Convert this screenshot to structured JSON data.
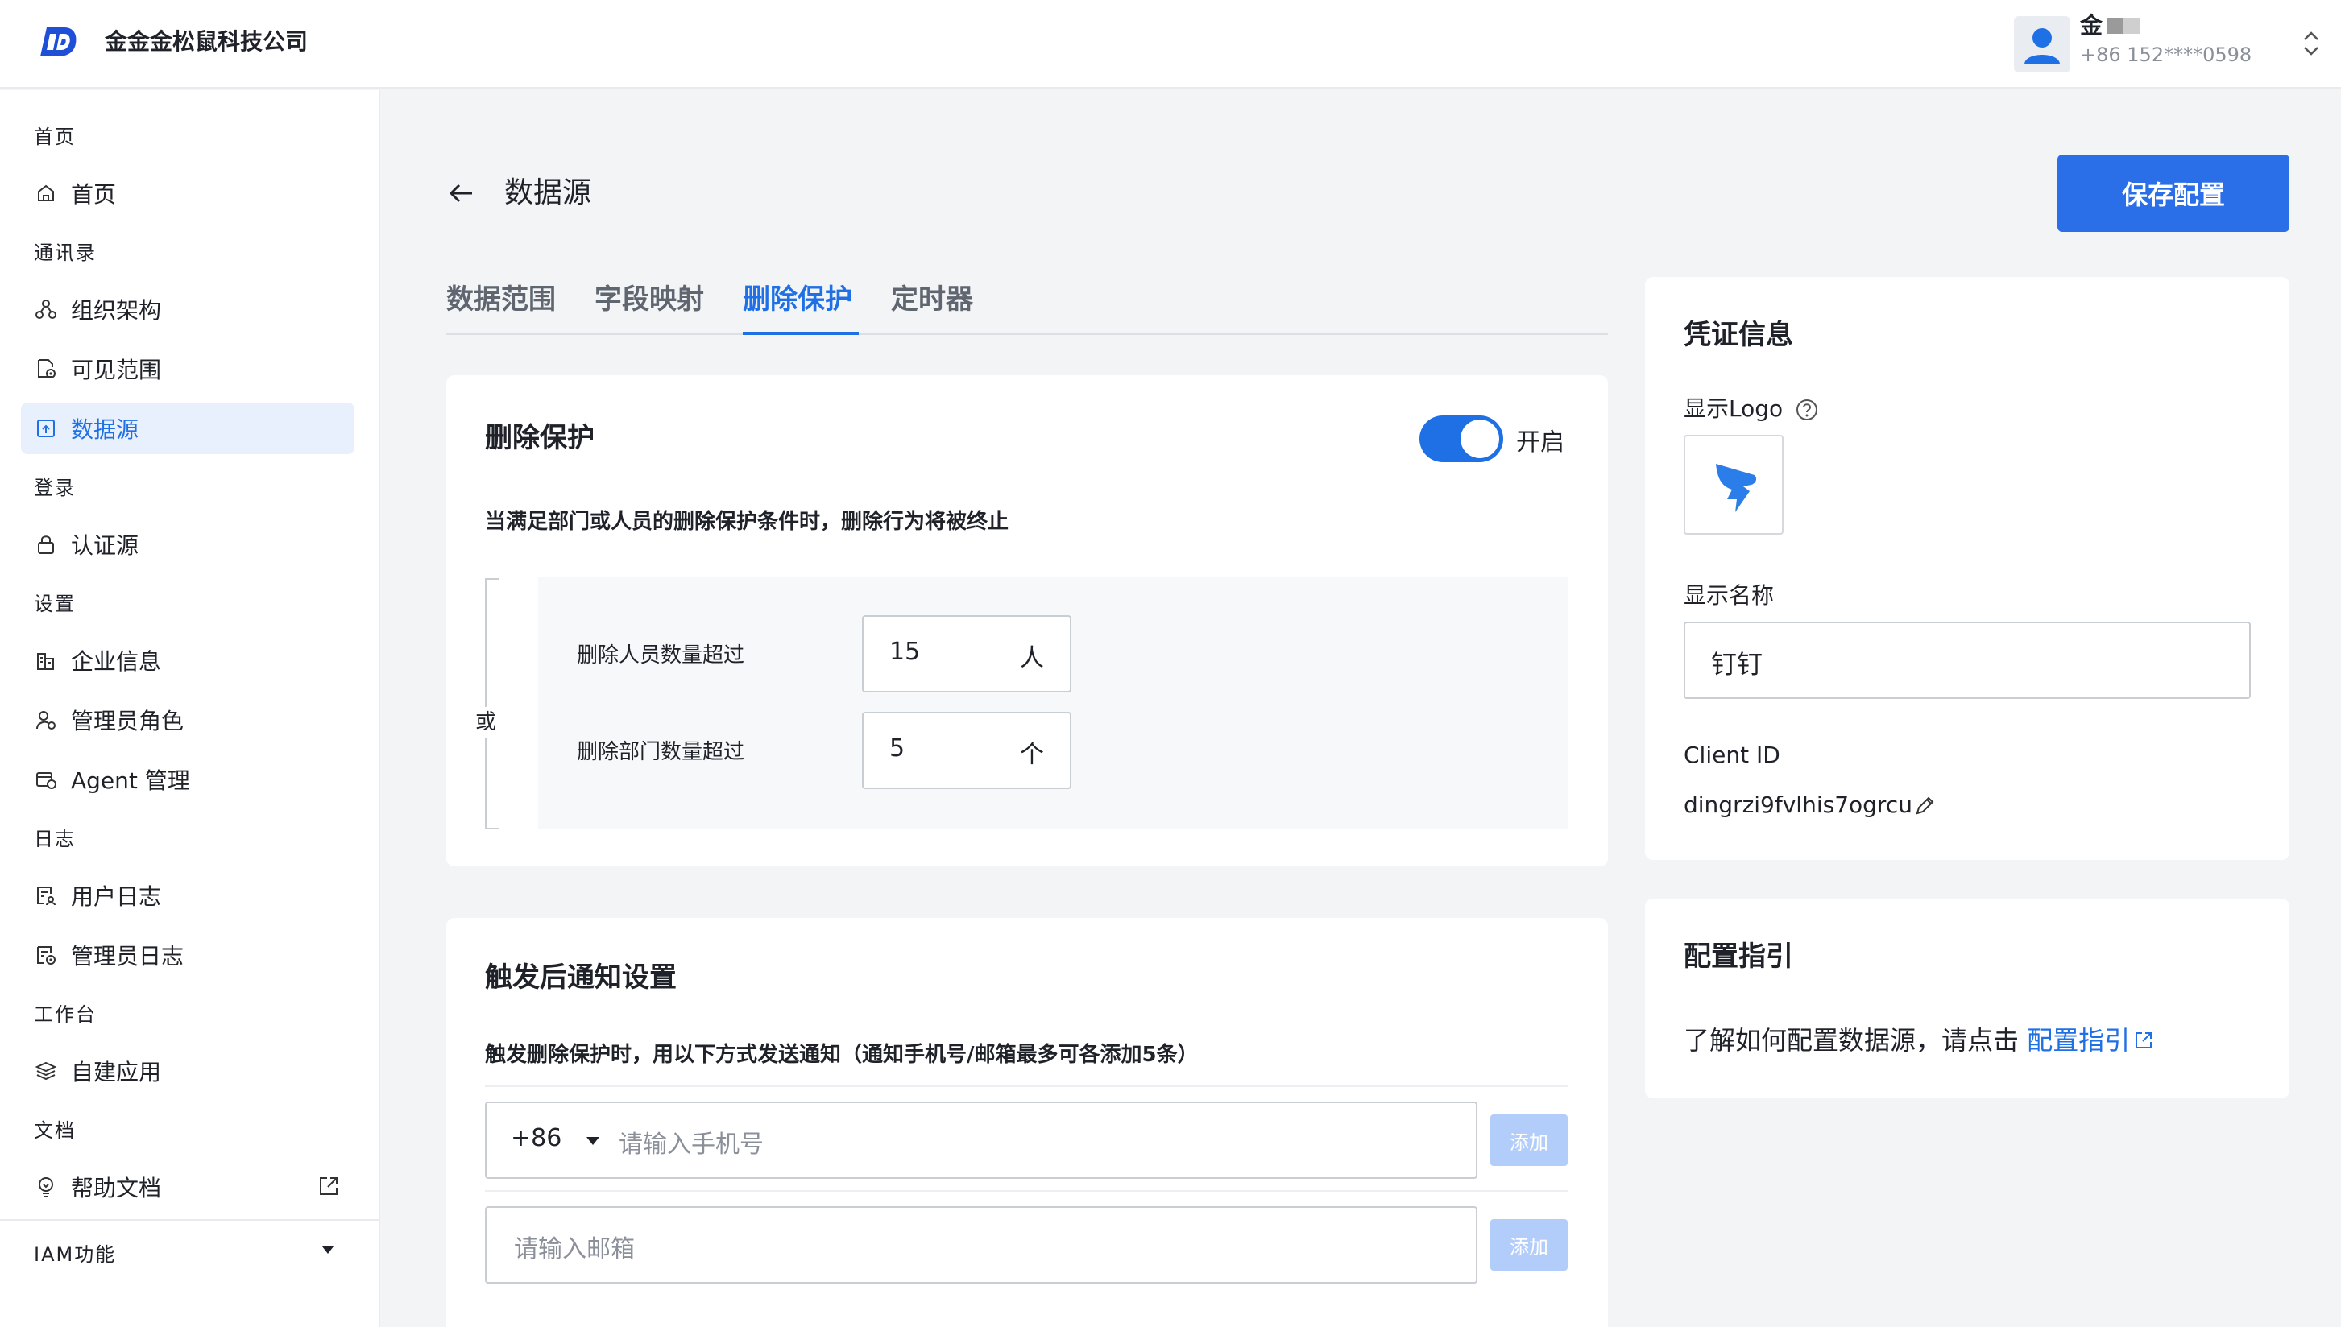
{
  "header": {
    "company": "金金金松鼠科技公司",
    "user_name": "金",
    "user_phone": "+86 152****0598"
  },
  "sidebar": {
    "groups": [
      {
        "label": "首页"
      },
      {
        "label": "通讯录"
      },
      {
        "label": "登录"
      },
      {
        "label": "设置"
      },
      {
        "label": "日志"
      },
      {
        "label": "工作台"
      },
      {
        "label": "文档"
      }
    ],
    "items": [
      {
        "label": "首页",
        "icon": "home-icon"
      },
      {
        "label": "组织架构",
        "icon": "org-structure-icon"
      },
      {
        "label": "可见范围",
        "icon": "visibility-scope-icon"
      },
      {
        "label": "数据源",
        "icon": "data-source-icon",
        "active": true
      },
      {
        "label": "认证源",
        "icon": "lock-icon"
      },
      {
        "label": "企业信息",
        "icon": "building-icon"
      },
      {
        "label": "管理员角色",
        "icon": "admin-role-icon"
      },
      {
        "label": "Agent 管理",
        "icon": "agent-icon"
      },
      {
        "label": "用户日志",
        "icon": "user-log-icon"
      },
      {
        "label": "管理员日志",
        "icon": "admin-log-icon"
      },
      {
        "label": "自建应用",
        "icon": "layers-icon"
      },
      {
        "label": "帮助文档",
        "icon": "lightbulb-icon"
      }
    ],
    "iam": "IAM功能"
  },
  "page": {
    "title": "数据源",
    "save_label": "保存配置"
  },
  "tabs": [
    {
      "label": "数据范围"
    },
    {
      "label": "字段映射"
    },
    {
      "label": "删除保护",
      "active": true
    },
    {
      "label": "定时器"
    }
  ],
  "delete_protection": {
    "title": "删除保护",
    "toggle_label": "开启",
    "toggle_on": true,
    "description": "当满足部门或人员的删除保护条件时，删除行为将被终止",
    "or_label": "或",
    "conditions": [
      {
        "label": "删除人员数量超过",
        "value": "15",
        "unit": "人"
      },
      {
        "label": "删除部门数量超过",
        "value": "5",
        "unit": "个"
      }
    ]
  },
  "notification": {
    "title": "触发后通知设置",
    "description": "触发删除保护时，用以下方式发送通知（通知手机号/邮箱最多可各添加5条）",
    "country_code": "+86",
    "phone_placeholder": "请输入手机号",
    "email_placeholder": "请输入邮箱",
    "add_label": "添加"
  },
  "credentials": {
    "title": "凭证信息",
    "logo_label": "显示Logo",
    "name_label": "显示名称",
    "name_value": "钉钉",
    "client_id_label": "Client ID",
    "client_id_value": "dingrzi9fvlhis7ogrcu"
  },
  "guide": {
    "title": "配置指引",
    "text": "了解如何配置数据源，请点击 ",
    "link": "配置指引"
  },
  "colors": {
    "primary": "#1f6fe5",
    "button": "#2b6fe8",
    "disabled_button": "#b3cdfb"
  }
}
